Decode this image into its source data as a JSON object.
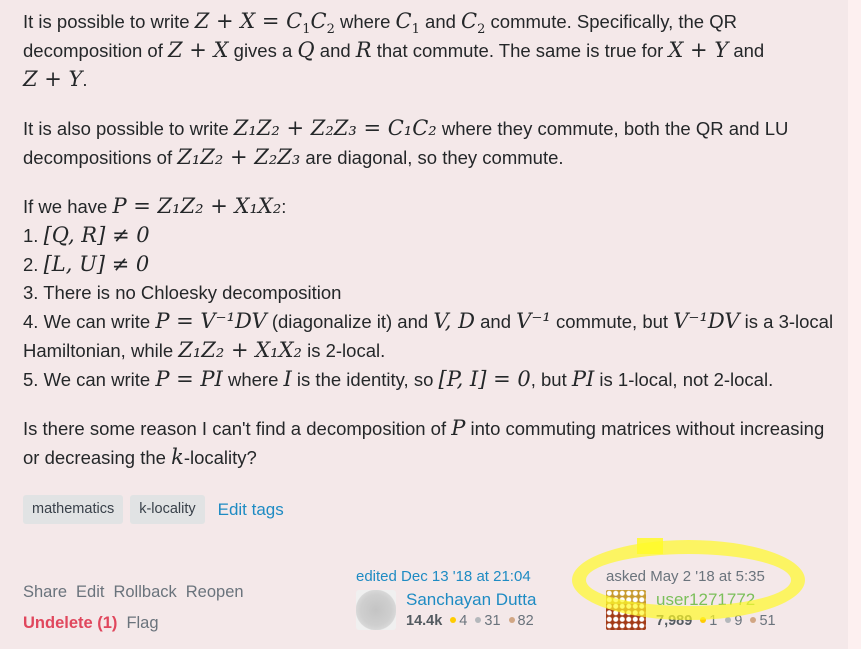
{
  "post": {
    "p1": {
      "t1": "It is possible to write ",
      "m1": "Z + X = C",
      "m1_sub1": "1",
      "m1b": "C",
      "m1_sub2": "2",
      "t2": " where ",
      "m2": "C",
      "m2_sub": "1",
      "t3": " and ",
      "m3": "C",
      "m3_sub": "2",
      "t4": " commute. Specifically, the QR decomposition of ",
      "m4": "Z + X",
      "t5": " gives a ",
      "m5": "Q",
      "t6": " and ",
      "m6": "R",
      "t7": " that commute. The same is true for ",
      "m7": "X + Y",
      "t8": " and ",
      "m8": "Z + Y",
      "t9": "."
    },
    "p2": {
      "t1": "It is also possible to write ",
      "m1": "Z₁Z₂ + Z₂Z₃ = C₁C₂",
      "t2": " where they commute, both the QR and LU decompositions of ",
      "m2": "Z₁Z₂ + Z₂Z₃",
      "t3": " are diagonal, so they commute."
    },
    "p3": {
      "intro_text": "If we have ",
      "intro_math": "P = Z₁Z₂ + X₁X₂",
      "intro_colon": ":",
      "items": [
        {
          "num": "1. ",
          "math": "[Q, R] ≠ 0"
        },
        {
          "num": "2. ",
          "math": "[L, U] ≠ 0"
        },
        {
          "num": "3. ",
          "text": "There is no Chloesky decomposition"
        }
      ],
      "item4": {
        "num": "4. ",
        "t1": "We can write ",
        "m1": "P = V⁻¹DV",
        "t2": " (diagonalize it) and ",
        "m2": "V, D",
        "t3": " and ",
        "m3": "V⁻¹",
        "t4": " commute, but ",
        "m4": "V⁻¹DV",
        "t5": " is a 3-local Hamiltonian, while ",
        "m5": "Z₁Z₂ + X₁X₂",
        "t6": " is 2-local."
      },
      "item5": {
        "num": "5. ",
        "t1": "We can write ",
        "m1": "P = PI",
        "t2": " where ",
        "m2": "I",
        "t3": " is the identity, so ",
        "m3": "[P, I] = 0",
        "t4": ", but ",
        "m4": "PI",
        "t5": " is 1-local, not 2-local."
      }
    },
    "p4": {
      "t1": "Is there some reason I can't find a decomposition of ",
      "m1": "P",
      "t2": " into commuting matrices without increasing or decreasing the ",
      "m2": "k",
      "t3": "-locality?"
    }
  },
  "tags": {
    "items": [
      "mathematics",
      "k-locality"
    ],
    "edit_label": "Edit tags"
  },
  "actions": {
    "row1": [
      "Share",
      "Edit",
      "Rollback",
      "Reopen"
    ],
    "undelete": "Undelete (1)",
    "flag": "Flag"
  },
  "editor": {
    "label": "edited Dec 13 '18 at 21:04",
    "name": "Sanchayan Dutta",
    "reputation": "14.4k",
    "gold": "4",
    "silver": "31",
    "bronze": "82"
  },
  "asker": {
    "label": "asked May 2 '18 at 5:35",
    "name": "user1271772",
    "reputation": "7,989",
    "gold": "1",
    "silver": "9",
    "bronze": "51"
  },
  "colors": {
    "background": "#f4e8e9",
    "link": "#1e8bc3",
    "undelete": "#e0475d",
    "highlight": "#fffa28"
  }
}
